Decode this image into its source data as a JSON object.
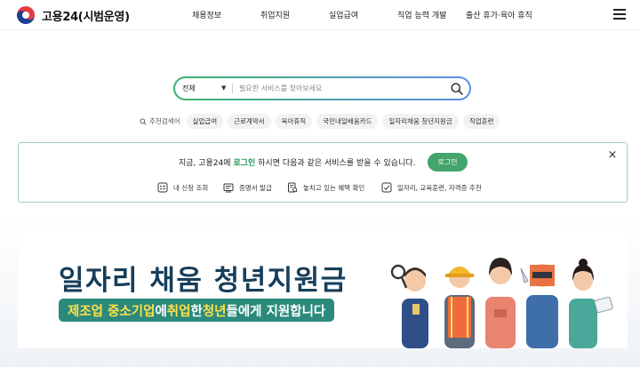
{
  "header": {
    "logo_text": "고용24(시범운영)",
    "nav": [
      "채용정보",
      "취업지원",
      "실업급여",
      "직업 능력 개발",
      "출산 휴가·육아 휴직"
    ]
  },
  "search": {
    "category": "전체",
    "placeholder": "필요한 서비스를 찾아보세요"
  },
  "keywords": {
    "label": "추천검색어",
    "items": [
      "실업급여",
      "근로계약서",
      "육아휴직",
      "국민내일배움카드",
      "일자리채움 청년지원금",
      "직업훈련"
    ]
  },
  "notice": {
    "text_before": "지금, 고용24에 ",
    "text_highlight": "로그인",
    "text_after": " 하시면 다음과 같은 서비스를 받을 수 있습니다.",
    "login_button": "로그인",
    "close": "×",
    "services": [
      "내 신청 조회",
      "증명서 발급",
      "놓치고 있는 혜택 확인",
      "일자리, 교육훈련, 자격증 추천"
    ]
  },
  "banner": {
    "title": "일자리 채움 청년지원금",
    "sub_1": "제조업 중소기업",
    "sub_2": "에 ",
    "sub_3": "취업",
    "sub_4": "한 ",
    "sub_5": "청년",
    "sub_6": "들에게 지원합니다"
  },
  "colors": {
    "accent_green": "#43a56b",
    "banner_navy": "#173e5a",
    "banner_teal": "#2b8a7b",
    "banner_yellow": "#ffe14a"
  }
}
